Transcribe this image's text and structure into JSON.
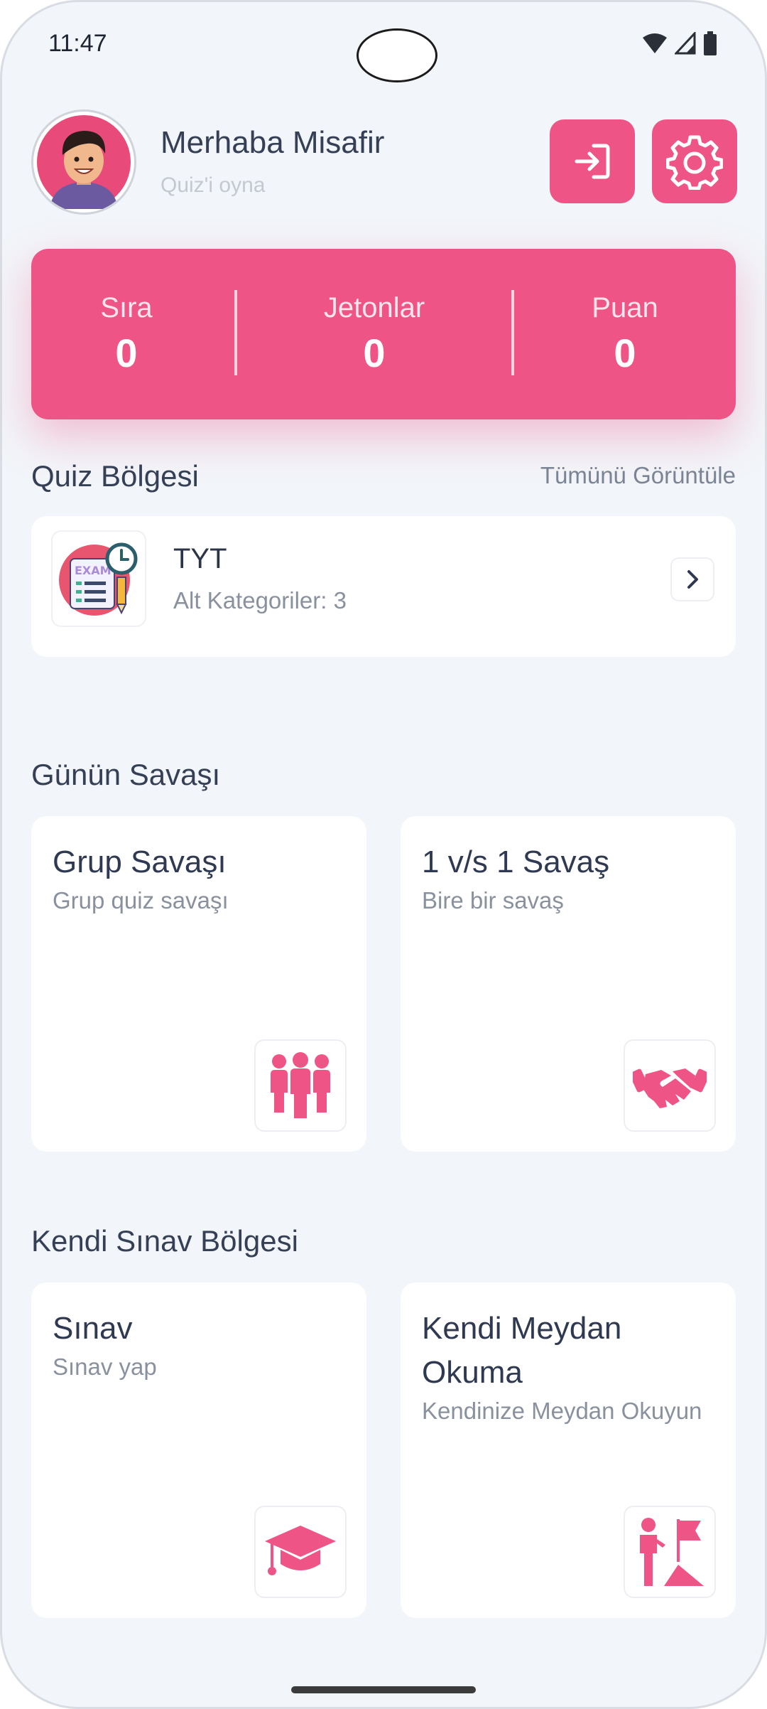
{
  "status_bar": {
    "time": "11:47"
  },
  "header": {
    "greeting": "Merhaba Misafir",
    "subtitle": "Quiz'i oyna"
  },
  "stats": [
    {
      "label": "Sıra",
      "value": "0"
    },
    {
      "label": "Jetonlar",
      "value": "0"
    },
    {
      "label": "Puan",
      "value": "0"
    }
  ],
  "quiz_zone": {
    "title": "Quiz Bölgesi",
    "view_all": "Tümünü Görüntüle",
    "item": {
      "thumb_text": "EXAM",
      "title": "TYT",
      "subtitle": "Alt Kategoriler: 3"
    }
  },
  "daily_battle": {
    "title": "Günün Savaşı",
    "cards": [
      {
        "title": "Grup Savaşı",
        "subtitle": "Grup quiz savaşı"
      },
      {
        "title": "1 v/s 1 Savaş",
        "subtitle": "Bire bir savaş"
      }
    ]
  },
  "self_exam": {
    "title": "Kendi Sınav Bölgesi",
    "cards": [
      {
        "title": "Sınav",
        "subtitle": "Sınav yap"
      },
      {
        "title": "Kendi Meydan Okuma",
        "subtitle": "Kendinize Meydan Okuyun"
      }
    ]
  },
  "colors": {
    "accent": "#ef5486",
    "background": "#f2f5f9",
    "text_dark": "#354056",
    "text_muted": "#8a919e"
  },
  "icons": [
    "login-icon",
    "gear-icon",
    "chevron-right-icon",
    "group-icon",
    "handshake-icon",
    "graduation-cap-icon",
    "challenge-flag-icon"
  ]
}
